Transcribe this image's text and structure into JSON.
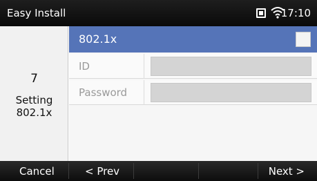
{
  "statusbar": {
    "title": "Easy Install",
    "time": "17:10",
    "icons": [
      "sim-card-icon",
      "wifi-icon"
    ]
  },
  "step": {
    "number": "7",
    "label_line1": "Setting",
    "label_line2": "802.1x"
  },
  "form": {
    "header_label": "802.1x",
    "header_checked": false,
    "fields": [
      {
        "label": "ID",
        "value": ""
      },
      {
        "label": "Password",
        "value": ""
      }
    ]
  },
  "softkeys": {
    "cancel": "Cancel",
    "prev": "< Prev",
    "next": "Next >"
  },
  "colors": {
    "header_bar": "#5574b8",
    "status_bar": "#111111",
    "step_panel": "#f1f1f1",
    "input_disabled": "#d4d4d4"
  }
}
